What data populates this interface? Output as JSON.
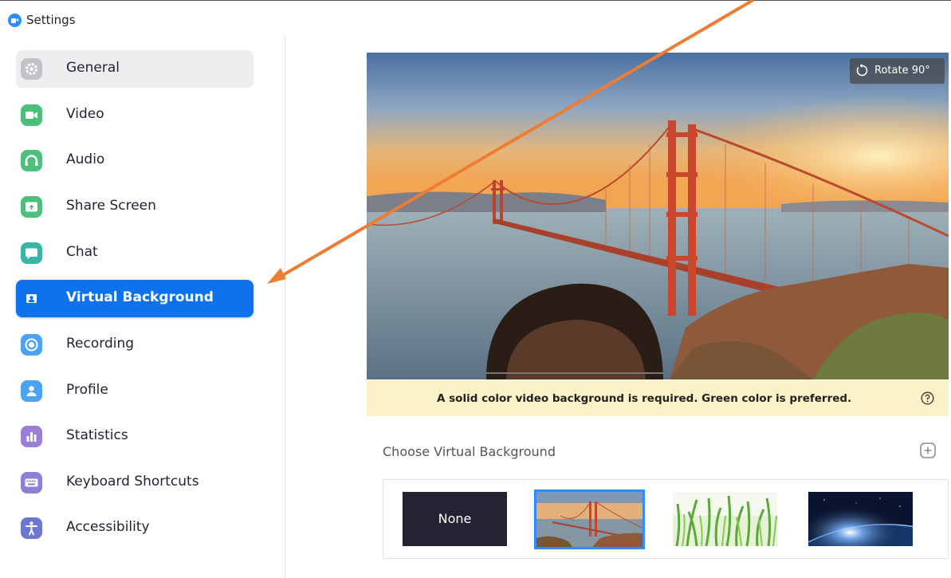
{
  "window": {
    "title": "Settings"
  },
  "sidebar": {
    "items": [
      {
        "label": "General",
        "icon": "gear-icon",
        "color": "#b9b9c0"
      },
      {
        "label": "Video",
        "icon": "video-camera-icon",
        "color": "#4cc07a"
      },
      {
        "label": "Audio",
        "icon": "headphones-icon",
        "color": "#4cc07a"
      },
      {
        "label": "Share Screen",
        "icon": "share-screen-icon",
        "color": "#4cc07a"
      },
      {
        "label": "Chat",
        "icon": "chat-bubble-icon",
        "color": "#39b5a4"
      },
      {
        "label": "Virtual Background",
        "icon": "portrait-icon",
        "color": "#0e72ed",
        "active": true
      },
      {
        "label": "Recording",
        "icon": "record-icon",
        "color": "#4aa3f5"
      },
      {
        "label": "Profile",
        "icon": "person-icon",
        "color": "#4aa3f5"
      },
      {
        "label": "Statistics",
        "icon": "bar-chart-icon",
        "color": "#9b7fd4"
      },
      {
        "label": "Keyboard Shortcuts",
        "icon": "keyboard-icon",
        "color": "#8a80d6"
      },
      {
        "label": "Accessibility",
        "icon": "accessibility-icon",
        "color": "#6d76d0"
      }
    ]
  },
  "preview": {
    "rotate_label": "Rotate 90°",
    "notice": "A solid color video background is required. Green color is preferred."
  },
  "choose": {
    "label": "Choose Virtual Background",
    "thumbnails": [
      {
        "label": "None"
      },
      {
        "name": "golden-gate-bridge",
        "selected": true
      },
      {
        "name": "grass"
      },
      {
        "name": "earth-from-space"
      }
    ]
  },
  "colors": {
    "accent": "#0e72ed",
    "selection": "#2d8cff",
    "notice_bg": "#fbf2c7",
    "annotation_arrow": "#ed7d31"
  }
}
